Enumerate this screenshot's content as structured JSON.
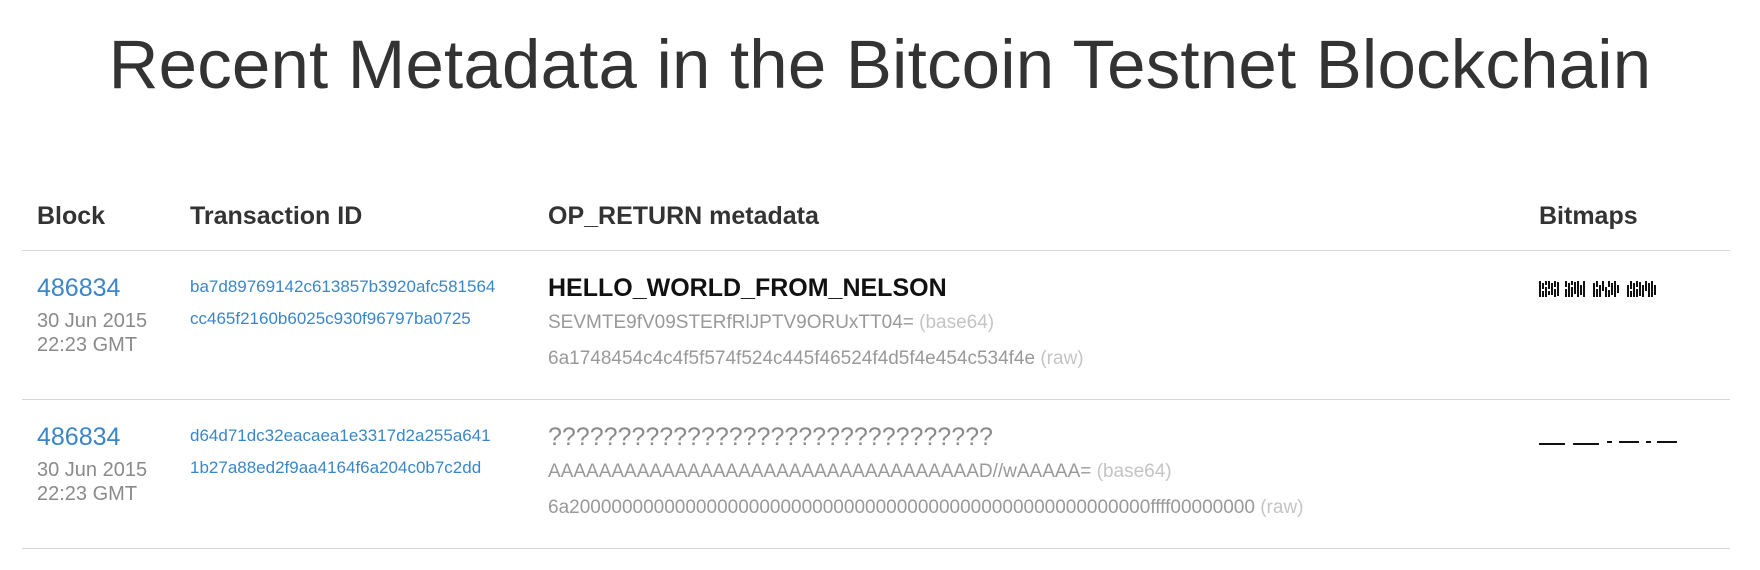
{
  "title": "Recent Metadata in the Bitcoin Testnet Blockchain",
  "columns": {
    "block": "Block",
    "txid": "Transaction ID",
    "metadata": "OP_RETURN metadata",
    "bitmaps": "Bitmaps"
  },
  "rows": [
    {
      "block": "486834",
      "date": "30 Jun 2015",
      "time": "22:23 GMT",
      "txid_line1": "ba7d89769142c613857b3920afc581564",
      "txid_line2": "cc465f2160b6025c930f96797ba0725",
      "text": "HELLO_WORLD_FROM_NELSON",
      "base64": "SEVMTE9fV09STERfRlJPTV9ORUxTT04=",
      "base64_tag": "(base64)",
      "raw": "6a1748454c4c4f5f574f524c445f46524f4d5f4e454c534f4e",
      "raw_tag": "(raw)"
    },
    {
      "block": "486834",
      "date": "30 Jun 2015",
      "time": "22:23 GMT",
      "txid_line1": "d64d71dc32eacaea1e3317d2a255a641",
      "txid_line2": "1b27a88ed2f9aa4164f6a204c0b7c2dd",
      "text": "????????????????????????????????",
      "base64": "AAAAAAAAAAAAAAAAAAAAAAAAAAAAAAAAAAD//wAAAAA=",
      "base64_tag": "(base64)",
      "raw": "6a2000000000000000000000000000000000000000000000000000000ffff00000000",
      "raw_tag": "(raw)"
    }
  ]
}
